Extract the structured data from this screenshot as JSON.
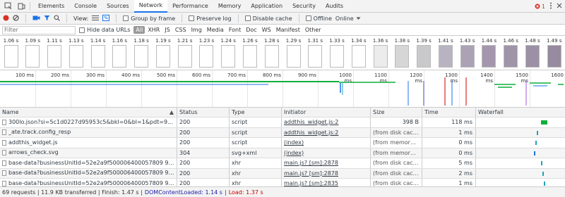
{
  "tabs": [
    {
      "label": "Elements",
      "active": false
    },
    {
      "label": "Console",
      "active": false
    },
    {
      "label": "Sources",
      "active": false
    },
    {
      "label": "Network",
      "active": true
    },
    {
      "label": "Performance",
      "active": false
    },
    {
      "label": "Memory",
      "active": false
    },
    {
      "label": "Application",
      "active": false
    },
    {
      "label": "Security",
      "active": false
    },
    {
      "label": "Audits",
      "active": false
    }
  ],
  "error_count": "1",
  "toolbar": {
    "view_label": "View:",
    "group_by_frame": "Group by frame",
    "preserve_log": "Preserve log",
    "disable_cache": "Disable cache",
    "offline": "Offline",
    "throttle_value": "Online"
  },
  "filterbar": {
    "filter_placeholder": "Filter",
    "hide_data_urls": "Hide data URLs",
    "types": [
      "All",
      "XHR",
      "JS",
      "CSS",
      "Img",
      "Media",
      "Font",
      "Doc",
      "WS",
      "Manifest",
      "Other"
    ],
    "active_type": "All"
  },
  "filmstrip": [
    {
      "time": "1.06 s",
      "shade": "#ffffff"
    },
    {
      "time": "1.09 s",
      "shade": "#ffffff"
    },
    {
      "time": "1.11 s",
      "shade": "#ffffff"
    },
    {
      "time": "1.13 s",
      "shade": "#ffffff"
    },
    {
      "time": "1.14 s",
      "shade": "#ffffff"
    },
    {
      "time": "1.16 s",
      "shade": "#ffffff"
    },
    {
      "time": "1.18 s",
      "shade": "#ffffff"
    },
    {
      "time": "1.19 s",
      "shade": "#ffffff"
    },
    {
      "time": "1.21 s",
      "shade": "#ffffff"
    },
    {
      "time": "1.23 s",
      "shade": "#ffffff"
    },
    {
      "time": "1.24 s",
      "shade": "#ffffff"
    },
    {
      "time": "1.26 s",
      "shade": "#ffffff"
    },
    {
      "time": "1.28 s",
      "shade": "#ffffff"
    },
    {
      "time": "1.29 s",
      "shade": "#ffffff"
    },
    {
      "time": "1.31 s",
      "shade": "#ffffff"
    },
    {
      "time": "1.33 s",
      "shade": "#ffffff"
    },
    {
      "time": "1.34 s",
      "shade": "#ffffff"
    },
    {
      "time": "1.36 s",
      "shade": "#ececec"
    },
    {
      "time": "1.38 s",
      "shade": "#d6d6d6"
    },
    {
      "time": "1.39 s",
      "shade": "#c9c9cc"
    },
    {
      "time": "1.41 s",
      "shade": "#b9b2c0"
    },
    {
      "time": "1.43 s",
      "shade": "#aba2b6"
    },
    {
      "time": "1.44 s",
      "shade": "#a497ad"
    },
    {
      "time": "1.46 s",
      "shade": "#a094a8"
    },
    {
      "time": "1.48 s",
      "shade": "#9c90a4"
    },
    {
      "time": "1.49 s",
      "shade": "#978b9f"
    }
  ],
  "overview_ticks": [
    "100 ms",
    "200 ms",
    "300 ms",
    "400 ms",
    "500 ms",
    "600 ms",
    "700 ms",
    "800 ms",
    "900 ms",
    "1000 ms",
    "1100 ms",
    "1200 ms",
    "1300 ms",
    "1400 ms",
    "1500 ms",
    "1600"
  ],
  "columns": {
    "name": "Name",
    "status": "Status",
    "type": "Type",
    "initiator": "Initiator",
    "size": "Size",
    "time": "Time",
    "waterfall": "Waterfall"
  },
  "rows": [
    {
      "name": "300lo.json?si=5c1d0227d95953c5&bkl=0&bl=1&pdt=957&...ipb=1...",
      "status": "200",
      "type": "script",
      "initiator": "addthis_widget.js:2",
      "init_link": true,
      "size": "398 B",
      "time": "118 ms"
    },
    {
      "name": "_ate.track.config_resp",
      "status": "200",
      "type": "script",
      "initiator": "addthis_widget.js:2",
      "init_link": true,
      "size": "(from disk cache)",
      "time": "1 ms"
    },
    {
      "name": "addthis_widget.js",
      "status": "200",
      "type": "script",
      "initiator": "(index)",
      "init_link": true,
      "size": "(from memory cac...",
      "time": "0 ms"
    },
    {
      "name": "arrows_check.svg",
      "status": "304",
      "type": "svg+xml",
      "initiator": "(index)",
      "init_link": true,
      "size": "(from memory cac...",
      "time": "0 ms"
    },
    {
      "name": "base-data?businessUnitId=52e2a9f500006400057809 9e&locale=e...",
      "status": "200",
      "type": "xhr",
      "initiator": "main.js? [sm]:2878",
      "init_link": true,
      "size": "(from disk cache)",
      "time": "5 ms"
    },
    {
      "name": "base-data?businessUnitId=52e2a9f500006400057809 9e&locale=e...",
      "status": "200",
      "type": "xhr",
      "initiator": "main.js? [sm]:2878",
      "init_link": true,
      "size": "(from disk cache)",
      "time": "2 ms"
    },
    {
      "name": "base-data?businessUnitId=52e2a9f500006400057809 9e&...lationF...",
      "status": "200",
      "type": "xhr",
      "initiator": "main.js? [sm]:2835",
      "init_link": true,
      "size": "(from disk cache)",
      "time": "1 ms"
    }
  ],
  "waterfall_colors": {
    "green": "#0fae3a",
    "blue": "#1a73e8",
    "teal": "#21a2b7"
  },
  "status_bar": {
    "summary": "69 requests | 11.9 KB transferred | Finish: 1.47 s |",
    "dcl": "DOMContentLoaded: 1.14 s",
    "sep": "|",
    "load": "Load: 1.37 s"
  }
}
